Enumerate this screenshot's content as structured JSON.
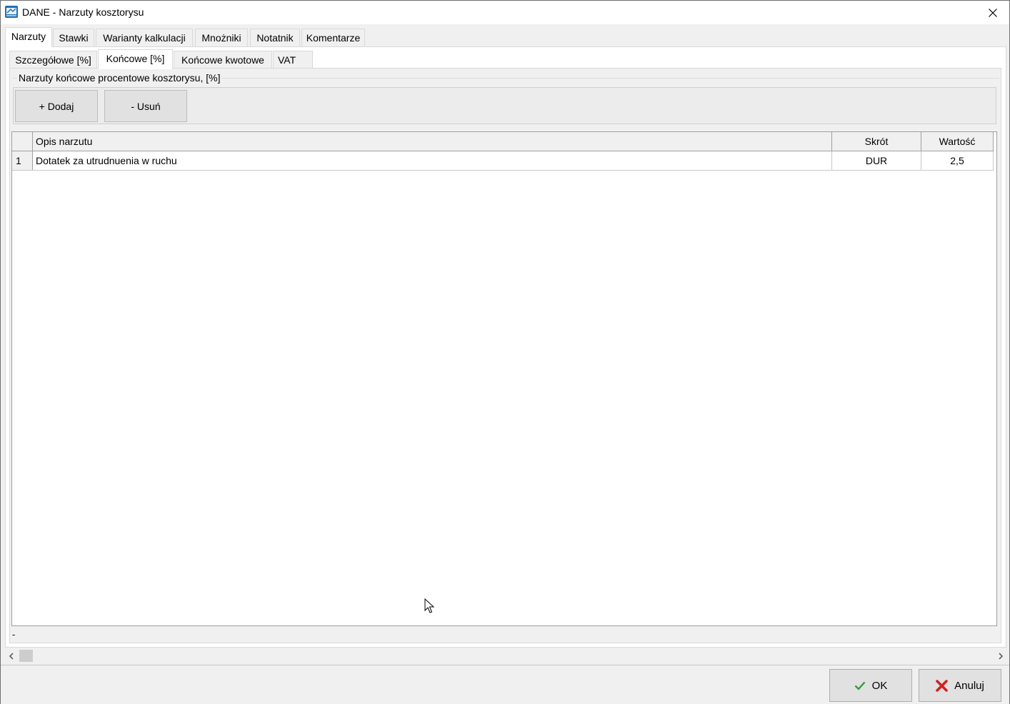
{
  "window": {
    "title": "DANE - Narzuty kosztorysu"
  },
  "main_tabs": [
    {
      "label": "Narzuty",
      "active": true
    },
    {
      "label": "Stawki"
    },
    {
      "label": "Warianty kalkulacji"
    },
    {
      "label": "Mnożniki"
    },
    {
      "label": "Notatnik"
    },
    {
      "label": "Komentarze"
    }
  ],
  "sub_tabs": [
    {
      "label": "Szczegółowe [%]"
    },
    {
      "label": "Końcowe [%]",
      "active": true
    },
    {
      "label": "Końcowe kwotowe"
    },
    {
      "label": "VAT"
    }
  ],
  "group": {
    "title": "Narzuty końcowe procentowe kosztorysu, [%]",
    "add_label": "+ Dodaj",
    "remove_label": "- Usuń"
  },
  "table": {
    "columns": [
      "Opis narzutu",
      "Skrót",
      "Wartość"
    ],
    "rows": [
      {
        "num": "1",
        "desc": "Dotatek za utrudnuenia w ruchu",
        "code": "DUR",
        "value": "2,5"
      }
    ]
  },
  "status_text": "-",
  "footer": {
    "ok_label": "OK",
    "cancel_label": "Anuluj"
  },
  "colors": {
    "ok_check": "#2e9e3e",
    "cancel_x": "#d42020"
  }
}
